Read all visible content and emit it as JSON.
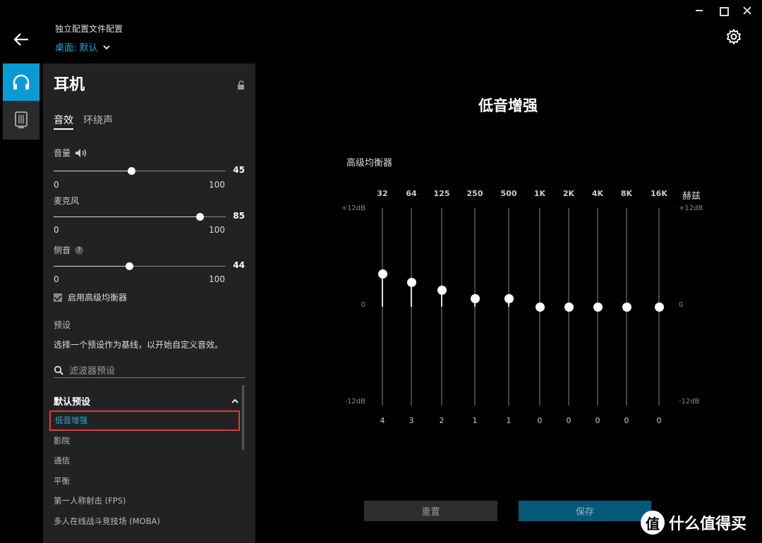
{
  "header": {
    "profile_title": "独立配置文件配置",
    "profile_selected": "桌面: 默认"
  },
  "panel": {
    "title": "耳机",
    "tabs": [
      {
        "label": "音效",
        "active": true
      },
      {
        "label": "环绕声",
        "active": false
      }
    ],
    "sliders": [
      {
        "label": "音量",
        "value": "45",
        "min": "0",
        "max": "100",
        "level": 0.45
      },
      {
        "label": "麦克风",
        "value": "85",
        "min": "0",
        "max": "100",
        "level": 0.85
      },
      {
        "label": "侧音",
        "value": "44",
        "min": "0",
        "max": "100",
        "level": 0.44
      }
    ],
    "help_icon_text": "?",
    "advanced_eq_checkbox": {
      "label": "启用高级均衡器",
      "checked": true
    },
    "presets_heading": "预设",
    "presets_description": "选择一个预设作为基线，以开始自定义音效。",
    "search_placeholder": "滤波器预设",
    "group_title": "默认预设",
    "presets": [
      {
        "label": "低音增强",
        "active": true
      },
      {
        "label": "影院",
        "active": false
      },
      {
        "label": "通信",
        "active": false
      },
      {
        "label": "平衡",
        "active": false
      },
      {
        "label": "第一人称射击 (FPS)",
        "active": false
      },
      {
        "label": "多人在线战斗竞技场 (MOBA)",
        "active": false
      }
    ]
  },
  "eq": {
    "title": "低音增强",
    "label": "高级均衡器",
    "unit": "赫兹",
    "db_top": "+12dB",
    "db_mid": "0",
    "db_bottom": "-12dB",
    "range_db": [
      -12,
      12
    ],
    "bands": [
      {
        "freq": "32",
        "value": 4
      },
      {
        "freq": "64",
        "value": 3
      },
      {
        "freq": "125",
        "value": 2
      },
      {
        "freq": "250",
        "value": 1
      },
      {
        "freq": "500",
        "value": 1
      },
      {
        "freq": "1K",
        "value": 0
      },
      {
        "freq": "2K",
        "value": 0
      },
      {
        "freq": "4K",
        "value": 0
      },
      {
        "freq": "8K",
        "value": 0
      },
      {
        "freq": "16K",
        "value": 0
      }
    ],
    "reset_label": "重置",
    "save_label": "保存"
  },
  "watermark": {
    "badge": "值",
    "text": "什么值得买"
  },
  "colors": {
    "accent": "#0a9bd4",
    "highlight_border": "#e03a3a"
  }
}
